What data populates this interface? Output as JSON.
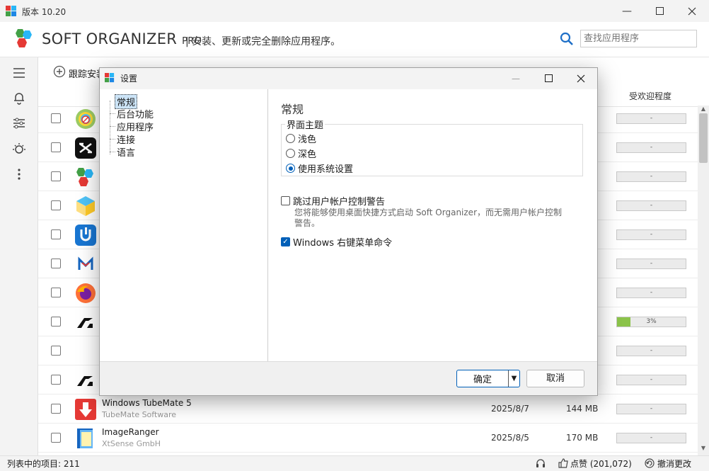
{
  "window": {
    "title": "版本 10.20"
  },
  "header": {
    "brand": "SOFT ORGANIZER",
    "brand_suffix": "PRO",
    "tagline": "| 安装、更新或完全删除应用程序。",
    "search_placeholder": "查找应用程序"
  },
  "toolbar": {
    "track_install": "跟踪安装"
  },
  "list": {
    "col_popularity": "受欢迎程度",
    "rows": [
      {
        "icon": "cd-icon",
        "name": "",
        "publisher": "",
        "date": "",
        "size": "",
        "popularity": "-",
        "pct": 0
      },
      {
        "icon": "capcut-icon",
        "name": "",
        "publisher": "",
        "date": "",
        "size": "",
        "popularity": "-",
        "pct": 0
      },
      {
        "icon": "soft-organizer-icon",
        "name": "",
        "publisher": "",
        "date": "",
        "size": "",
        "popularity": "-",
        "pct": 0
      },
      {
        "icon": "box-icon",
        "name": "",
        "publisher": "",
        "date": "",
        "size": "",
        "popularity": "-",
        "pct": 0
      },
      {
        "icon": "u-app-icon",
        "name": "",
        "publisher": "",
        "date": "",
        "size": "",
        "popularity": "-",
        "pct": 0
      },
      {
        "icon": "m-logo-icon",
        "name": "",
        "publisher": "",
        "date": "",
        "size": "",
        "popularity": "-",
        "pct": 0
      },
      {
        "icon": "firefox-icon",
        "name": "",
        "publisher": "",
        "date": "",
        "size": "",
        "popularity": "-",
        "pct": 0
      },
      {
        "icon": "autodesk-icon",
        "name": "",
        "publisher": "",
        "date": "",
        "size": "",
        "popularity": "3%",
        "pct": 20
      },
      {
        "icon": "blank-icon",
        "name": "",
        "publisher": "",
        "date": "",
        "size": "",
        "popularity": "-",
        "pct": 0
      },
      {
        "icon": "autodesk-icon",
        "name": "",
        "publisher": "",
        "date": "",
        "size": "",
        "popularity": "-",
        "pct": 0
      },
      {
        "icon": "tubemate-icon",
        "name": "Windows TubeMate 5",
        "publisher": "TubeMate Software",
        "date": "2025/8/7",
        "size": "144 MB",
        "popularity": "-",
        "pct": 0
      },
      {
        "icon": "imageranger-icon",
        "name": "ImageRanger",
        "publisher": "XtSense GmbH",
        "date": "2025/8/5",
        "size": "170 MB",
        "popularity": "-",
        "pct": 0
      }
    ]
  },
  "status": {
    "count": "列表中的项目: 211",
    "like": "点赞 (201,072)",
    "undo": "撤消更改"
  },
  "dialog": {
    "title": "设置",
    "nav": [
      "常规",
      "后台功能",
      "应用程序",
      "连接",
      "语言"
    ],
    "section_title": "常规",
    "theme_group": "界面主题",
    "theme_options": [
      "浅色",
      "深色",
      "使用系统设置"
    ],
    "theme_selected": 2,
    "skip_uac_label": "跳过用户帐户控制警告",
    "skip_uac_checked": false,
    "skip_uac_desc": "您将能够使用桌面快捷方式启动 Soft Organizer，而无需用户帐户控制警告。",
    "context_menu_label": "Windows 右键菜单命令",
    "context_menu_checked": true,
    "ok": "确定",
    "cancel": "取消"
  },
  "colors": {
    "accent": "#005fb8",
    "popularity_fill": "#8bc34a"
  }
}
